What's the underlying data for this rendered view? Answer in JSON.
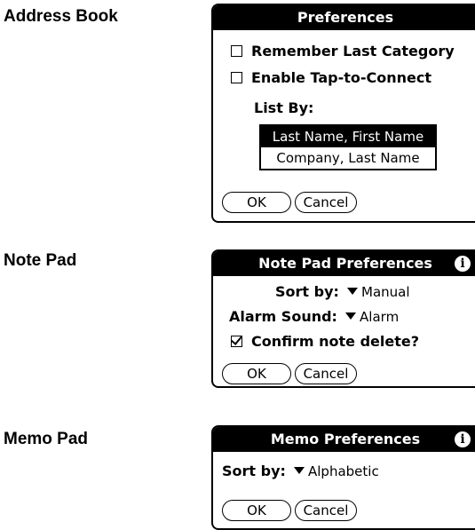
{
  "address_book": {
    "app_label": "Address Book",
    "title": "Preferences",
    "options": [
      {
        "label": "Remember Last Category",
        "checked": false
      },
      {
        "label": "Enable Tap-to-Connect",
        "checked": false
      }
    ],
    "list_by_label": "List By:",
    "list_items": [
      {
        "label": "Last Name, First Name",
        "selected": true
      },
      {
        "label": "Company, Last Name",
        "selected": false
      }
    ],
    "ok_label": "OK",
    "cancel_label": "Cancel"
  },
  "note_pad": {
    "app_label": "Note Pad",
    "title": "Note Pad Preferences",
    "info_icon": "i",
    "sort_label": "Sort by:",
    "sort_value": "Manual",
    "alarm_label": "Alarm Sound:",
    "alarm_value": "Alarm",
    "confirm_label": "Confirm note delete?",
    "confirm_checked": true,
    "ok_label": "OK",
    "cancel_label": "Cancel"
  },
  "memo_pad": {
    "app_label": "Memo Pad",
    "title": "Memo Preferences",
    "info_icon": "i",
    "sort_label": "Sort by:",
    "sort_value": "Alphabetic",
    "ok_label": "OK",
    "cancel_label": "Cancel"
  }
}
